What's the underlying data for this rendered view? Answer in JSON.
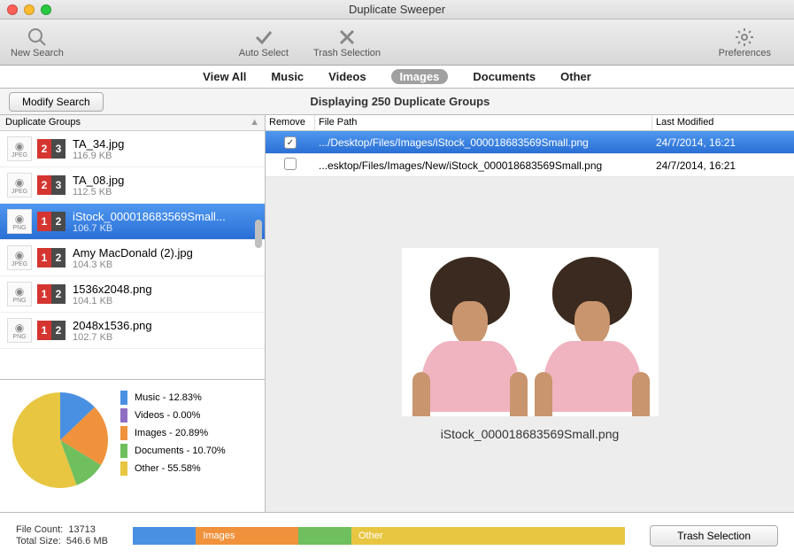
{
  "window": {
    "title": "Duplicate Sweeper"
  },
  "toolbar": {
    "new_search": "New Search",
    "auto_select": "Auto Select",
    "trash_selection": "Trash Selection",
    "preferences": "Preferences"
  },
  "filters": {
    "view_all": "View All",
    "music": "Music",
    "videos": "Videos",
    "images": "Images",
    "documents": "Documents",
    "other": "Other"
  },
  "subbar": {
    "modify": "Modify Search",
    "displaying": "Displaying 250 Duplicate Groups"
  },
  "sidebar_header": "Duplicate Groups",
  "groups": [
    {
      "badge": [
        "2",
        "3"
      ],
      "seg0": "red",
      "name": "TA_34.jpg",
      "size": "116.9 KB",
      "ext": "JPEG"
    },
    {
      "badge": [
        "2",
        "3"
      ],
      "seg0": "red",
      "name": "TA_08.jpg",
      "size": "112.5 KB",
      "ext": "JPEG"
    },
    {
      "badge": [
        "1",
        "2"
      ],
      "seg0": "red",
      "name": "iStock_000018683569Small...",
      "size": "106.7 KB",
      "ext": "PNG",
      "selected": true
    },
    {
      "badge": [
        "1",
        "2"
      ],
      "seg0": "red",
      "name": "Amy MacDonald (2).jpg",
      "size": "104.3 KB",
      "ext": "JPEG"
    },
    {
      "badge": [
        "1",
        "2"
      ],
      "seg0": "red",
      "name": "1536x2048.png",
      "size": "104.1 KB",
      "ext": "PNG"
    },
    {
      "badge": [
        "1",
        "2"
      ],
      "seg0": "red",
      "name": "2048x1536.png",
      "size": "102.7 KB",
      "ext": "PNG"
    }
  ],
  "chart_data": {
    "type": "pie",
    "series": [
      {
        "name": "Music",
        "value": 12.83,
        "color": "#4a90e2"
      },
      {
        "name": "Videos",
        "value": 0.0,
        "color": "#8e6fc1"
      },
      {
        "name": "Images",
        "value": 20.89,
        "color": "#f0923c"
      },
      {
        "name": "Documents",
        "value": 10.7,
        "color": "#6fbf5e"
      },
      {
        "name": "Other",
        "value": 55.58,
        "color": "#e8c642"
      }
    ],
    "legend_text": {
      "music": "Music - 12.83%",
      "videos": "Videos - 0.00%",
      "images": "Images - 20.89%",
      "documents": "Documents - 10.70%",
      "other": "Other - 55.58%"
    }
  },
  "detail": {
    "headers": {
      "remove": "Remove",
      "path": "File Path",
      "modified": "Last Modified"
    },
    "rows": [
      {
        "checked": true,
        "sel": true,
        "path": ".../Desktop/Files/Images/iStock_000018683569Small.png",
        "modified": "24/7/2014, 16:21"
      },
      {
        "checked": false,
        "sel": false,
        "path": "...esktop/Files/Images/New/iStock_000018683569Small.png",
        "modified": "24/7/2014, 16:21"
      }
    ],
    "preview_caption": "iStock_000018683569Small.png"
  },
  "footer": {
    "file_count_label": "File Count:",
    "file_count": "13713",
    "total_size_label": "Total Size:",
    "total_size": "546.6 MB",
    "bar_images": "Images",
    "bar_other": "Other",
    "trash": "Trash Selection"
  }
}
